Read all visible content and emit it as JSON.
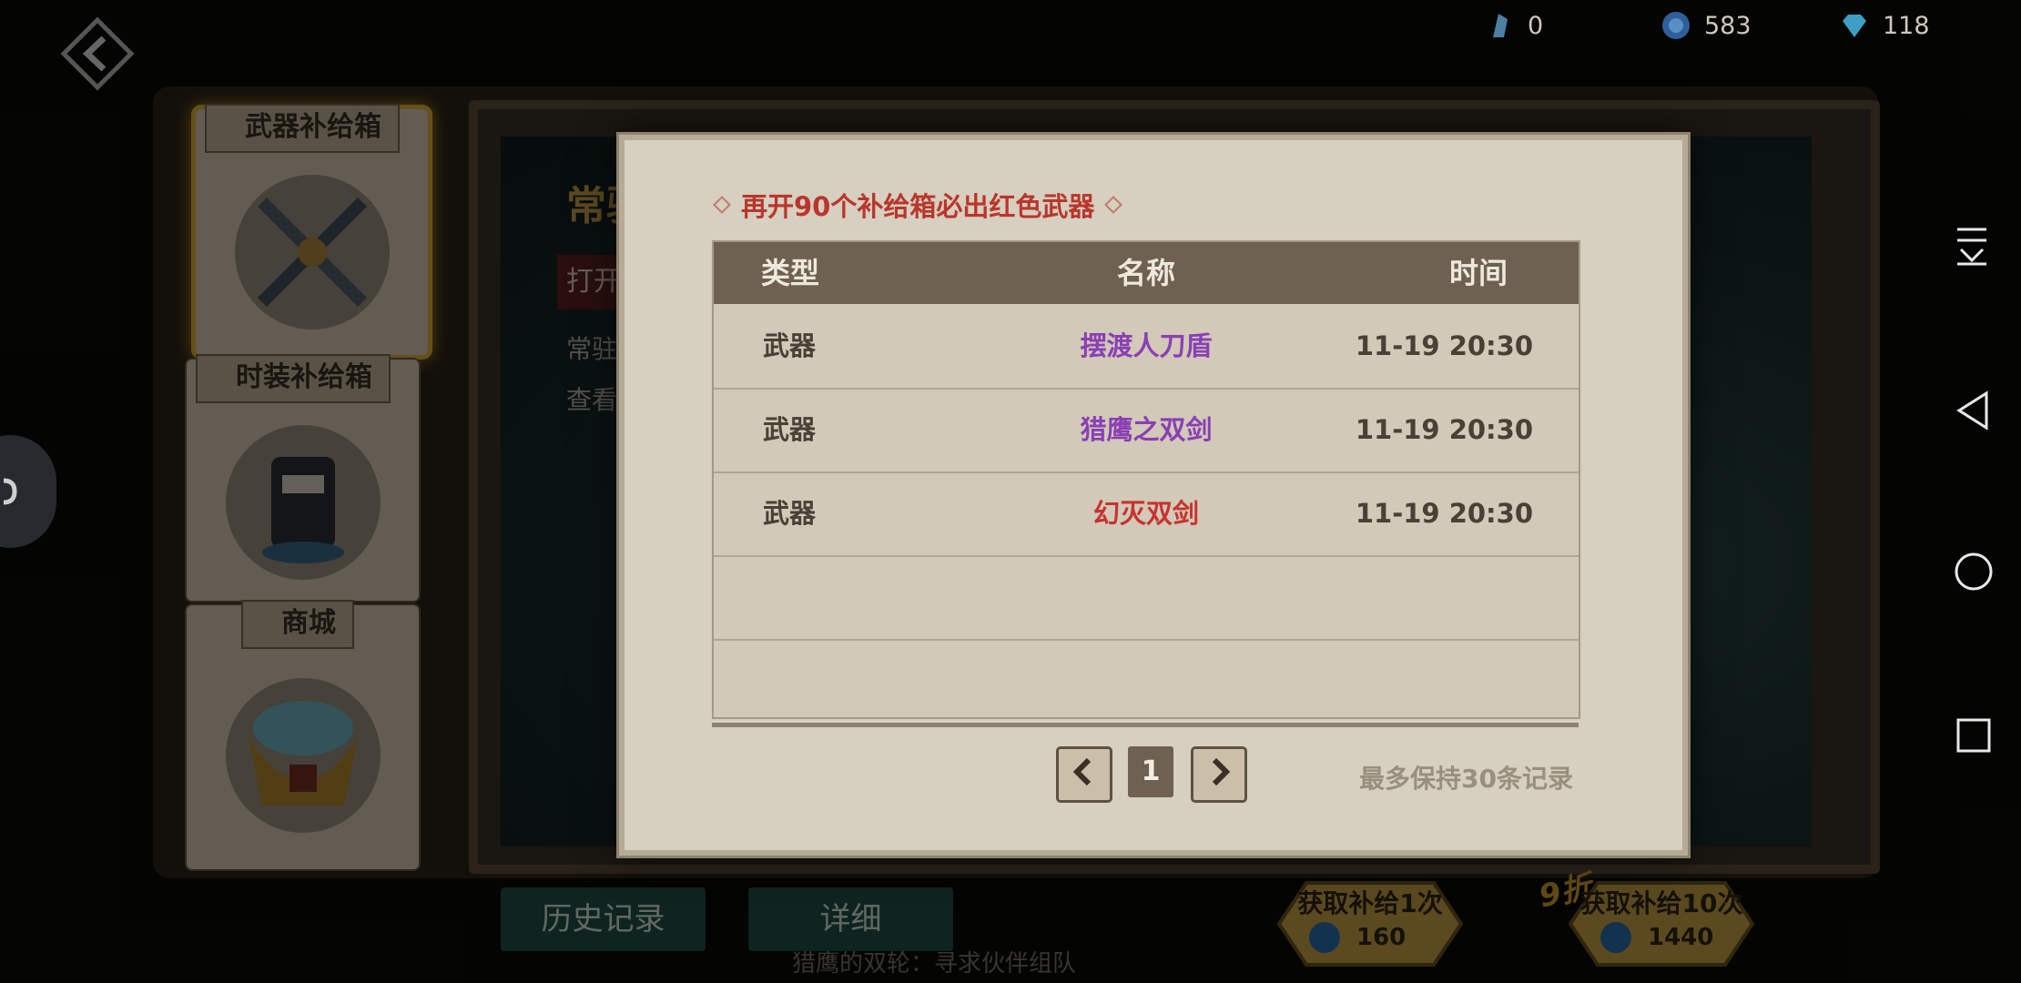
{
  "currencies": [
    {
      "icon": "crystal-icon",
      "value": "0"
    },
    {
      "icon": "coin-icon",
      "value": "583"
    },
    {
      "icon": "diamond-icon",
      "value": "118"
    }
  ],
  "sidebar": [
    {
      "label": "武器补给箱",
      "active": true
    },
    {
      "label": "时装补给箱",
      "active": false
    },
    {
      "label": "商城",
      "active": false
    }
  ],
  "background": {
    "title": "常驻",
    "open_button": "打开",
    "line1": "常驻",
    "line2": "查看",
    "history_button": "历史记录",
    "detail_button": "详细",
    "sale_tag": "9折",
    "buy_once": {
      "label": "获取补给1次",
      "cost": "160"
    },
    "buy_ten": {
      "label": "获取补给10次",
      "cost": "1440"
    },
    "chat_text": "猎鹰的双轮：寻求伙伴组队"
  },
  "modal": {
    "header": "再开90个补给箱必出红色武器",
    "columns": {
      "type": "类型",
      "name": "名称",
      "time": "时间"
    },
    "rows": [
      {
        "type": "武器",
        "name": "摆渡人刀盾",
        "time": "11-19  20:30",
        "color": "#8a3fb5"
      },
      {
        "type": "武器",
        "name": "猎鹰之双剑",
        "time": "11-19  20:30",
        "color": "#8a3fb5"
      },
      {
        "type": "武器",
        "name": "幻灭双剑",
        "time": "11-19  20:30",
        "color": "#c73330"
      }
    ],
    "page": "1",
    "note": "最多保持30条记录"
  }
}
